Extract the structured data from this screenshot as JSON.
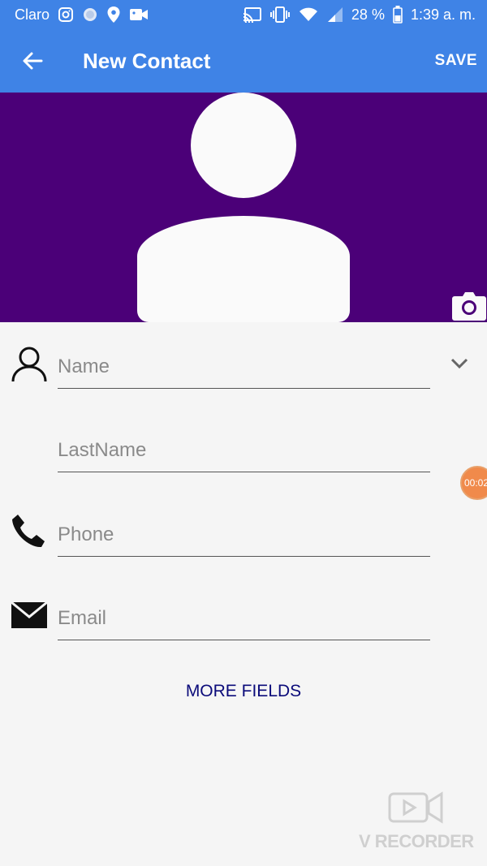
{
  "status_bar": {
    "carrier": "Claro",
    "battery": "28 %",
    "time": "1:39 a. m."
  },
  "app_bar": {
    "title": "New Contact",
    "save_label": "SAVE"
  },
  "form": {
    "name_placeholder": "Name",
    "lastname_placeholder": "LastName",
    "phone_placeholder": "Phone",
    "email_placeholder": "Email",
    "more_fields_label": "MORE FIELDS"
  },
  "overlay": {
    "recorder_timer": "00:02",
    "watermark_text": "V RECORDER"
  },
  "colors": {
    "app_bar": "#3f83e6",
    "photo_header": "#4b0078",
    "more_fields_text": "#0b0b7a"
  }
}
